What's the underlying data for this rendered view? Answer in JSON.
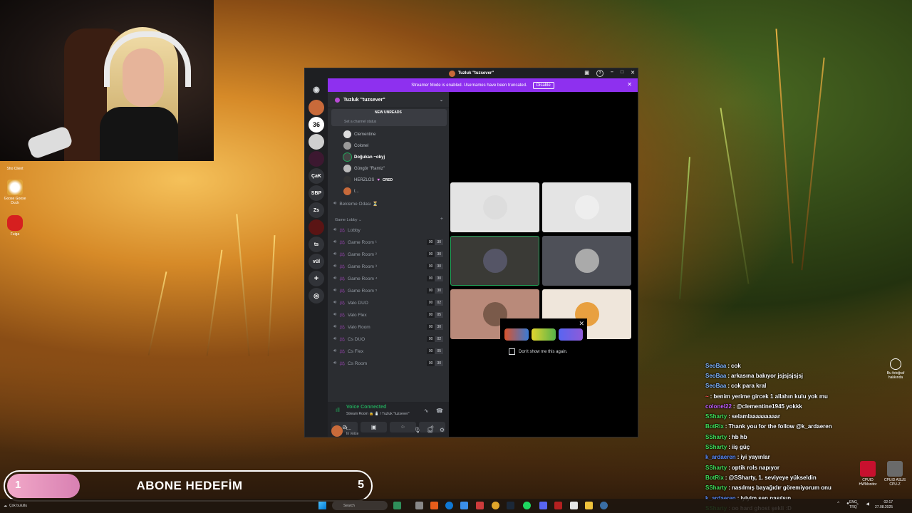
{
  "desktop": {
    "icons": [
      {
        "label": "Sho Client"
      },
      {
        "label": "Goose Goose Duck"
      },
      {
        "label": "Fuiga"
      }
    ],
    "photo_info": "Bu fotoğraf hakkında"
  },
  "discord": {
    "window_title": "Tuzluk \"tuzsever\"",
    "streamer_banner": {
      "text": "Streamer Mode is enabled. Usernames have been truncated.",
      "disable_label": "Disable"
    },
    "servers": [
      "36",
      "ÇaK",
      "SBP",
      "Zs",
      "ts",
      "vül"
    ],
    "guild_name": "Tuzluk \"tuzsever\"",
    "new_unreads": "NEW UNREADS",
    "channel_status": "Set a channel status",
    "voice_users": [
      {
        "name": "Clementine"
      },
      {
        "name": "Colonel"
      },
      {
        "name": "Doğukan ~obyj"
      },
      {
        "name": "Güngör \"Ramiz\""
      },
      {
        "name": "HERZLOS",
        "tag": "CRED"
      },
      {
        "name": "t..."
      }
    ],
    "waiting_room": "Bekleme Odası ⏳",
    "category": "Game Lobby",
    "channels": [
      {
        "name": "Lobby"
      },
      {
        "name": "Game Room ¹",
        "a": "00",
        "b": "30"
      },
      {
        "name": "Game Room ²",
        "a": "00",
        "b": "30"
      },
      {
        "name": "Game Room ³",
        "a": "00",
        "b": "30"
      },
      {
        "name": "Game Room ⁴",
        "a": "00",
        "b": "30"
      },
      {
        "name": "Game Room ⁵",
        "a": "00",
        "b": "30"
      },
      {
        "name": "Valo DUO",
        "a": "00",
        "b": "02"
      },
      {
        "name": "Valo Flex",
        "a": "00",
        "b": "05"
      },
      {
        "name": "Valo Room",
        "a": "00",
        "b": "30"
      },
      {
        "name": "Cs DUO",
        "a": "00",
        "b": "02"
      },
      {
        "name": "Cs Flex",
        "a": "00",
        "b": "05"
      },
      {
        "name": "Cs Room",
        "a": "00",
        "b": "30"
      }
    ],
    "voice_connected": {
      "title": "Voice Connected",
      "subtitle": "Stream Room 🔒 🧂 / Tuzluk \"tuzsever\""
    },
    "user": {
      "name": "t...",
      "status": "In voice"
    },
    "popup": {
      "dont_show": "Don't show me this again."
    },
    "tile_colors": [
      "#e4e4e4",
      "#e4e4e4",
      "#3a3a36",
      "#4e5058",
      "#b98a7a",
      "#efe6db"
    ]
  },
  "chat": [
    {
      "name": "SeoBaa",
      "color": "#7fb4ff",
      "msg": "cok"
    },
    {
      "name": "SeoBaa",
      "color": "#7fb4ff",
      "msg": "arkasına bakıyor jsjsjsjsjsj"
    },
    {
      "name": "SeoBaa",
      "color": "#7fb4ff",
      "msg": "cok para kral"
    },
    {
      "name": "~",
      "color": "#ff4f4f",
      "msg": "benim yerime gircek 1 allahın kulu yok mu"
    },
    {
      "name": "colonel22",
      "color": "#c05cff",
      "msg": "@clementine1945 yokkk"
    },
    {
      "name": "SSharty",
      "color": "#3fe05a",
      "msg": "selamlaaaaaaaaar"
    },
    {
      "name": "BotRix",
      "color": "#3fe05a",
      "msg": "Thank you for the follow @k_ardaeren"
    },
    {
      "name": "SSharty",
      "color": "#3fe05a",
      "msg": "hb hb"
    },
    {
      "name": "SSharty",
      "color": "#3fe05a",
      "msg": "iiş güç"
    },
    {
      "name": "k_ardaeren",
      "color": "#5a8cff",
      "msg": "iyi yayınlar"
    },
    {
      "name": "SSharty",
      "color": "#3fe05a",
      "msg": "optik rols napıyor"
    },
    {
      "name": "BotRix",
      "color": "#3fe05a",
      "msg": "@SSharty, 1. seviyeye yükseldin"
    },
    {
      "name": "SSharty",
      "color": "#3fe05a",
      "msg": "nasılmış bayağıdır göremiyorum onu"
    },
    {
      "name": "k_ardaeren",
      "color": "#5a8cff",
      "msg": "iyiyim sen nasılsın"
    },
    {
      "name": "SSharty",
      "color": "#3fe05a",
      "msg": "oo hard ghost şekli :D"
    }
  ],
  "goal": {
    "current": "1",
    "title": "ABONE HEDEFİM",
    "target": "5",
    "progress_fraction": 0.2
  },
  "taskbar": {
    "weather": "Çok bulutlu",
    "search": "Search",
    "lang": "ENG",
    "region": "TRQ",
    "time": "02:17",
    "date": "27.08.2025",
    "widgets": [
      "CPUID HWMonitor",
      "CPUID ASUS CPU-Z"
    ]
  }
}
